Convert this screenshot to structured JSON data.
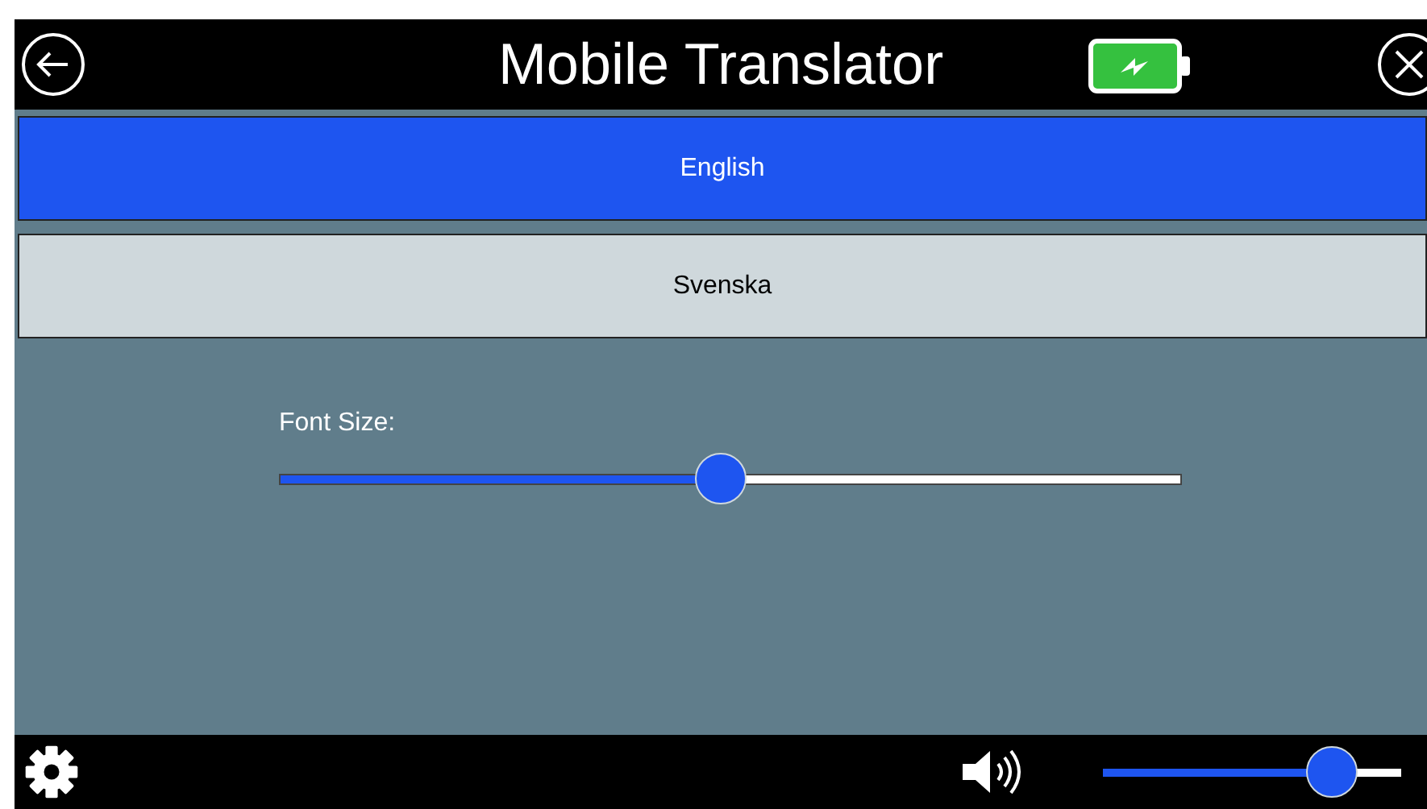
{
  "header": {
    "title": "Mobile Translator"
  },
  "languages": [
    {
      "label": "English",
      "selected": true
    },
    {
      "label": "Svenska",
      "selected": false
    }
  ],
  "font_size": {
    "label": "Font Size:",
    "level": 0.49
  },
  "volume": {
    "level": 0.76
  }
}
